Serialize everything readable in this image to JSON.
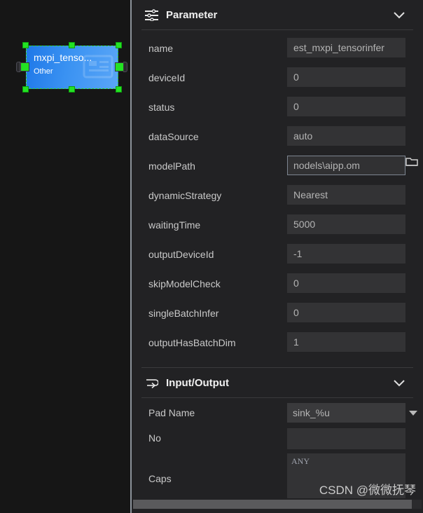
{
  "canvas": {
    "node": {
      "title": "mxpi_tenso...",
      "subtitle": "Other",
      "selected": true,
      "fill_color": "#3a92f2",
      "selection_color": "#23e223"
    }
  },
  "panel": {
    "parameter_section": {
      "title": "Parameter",
      "icon": "sliders-icon",
      "collapse_icon": "chevron-down-icon",
      "rows": [
        {
          "label": "name",
          "value": "est_mxpi_tensorinfer",
          "type": "text"
        },
        {
          "label": "deviceId",
          "value": "0",
          "type": "text"
        },
        {
          "label": "status",
          "value": "0",
          "type": "text"
        },
        {
          "label": "dataSource",
          "value": "auto",
          "type": "text"
        },
        {
          "label": "modelPath",
          "value": "nodels\\aipp.om",
          "type": "file"
        },
        {
          "label": "dynamicStrategy",
          "value": "Nearest",
          "type": "text"
        },
        {
          "label": "waitingTime",
          "value": "5000",
          "type": "text"
        },
        {
          "label": "outputDeviceId",
          "value": "-1",
          "type": "text"
        },
        {
          "label": "skipModelCheck",
          "value": "0",
          "type": "text"
        },
        {
          "label": "singleBatchInfer",
          "value": "0",
          "type": "text"
        },
        {
          "label": "outputHasBatchDim",
          "value": "1",
          "type": "text"
        }
      ]
    },
    "io_section": {
      "title": "Input/Output",
      "icon": "arrow-loop-icon",
      "collapse_icon": "chevron-down-icon",
      "pad_name_label": "Pad Name",
      "pad_name_value": "sink_%u",
      "no_label": "No",
      "no_value": "",
      "caps_label": "Caps",
      "caps_value": "ANY"
    }
  },
  "watermark": "CSDN @微微抚琴"
}
